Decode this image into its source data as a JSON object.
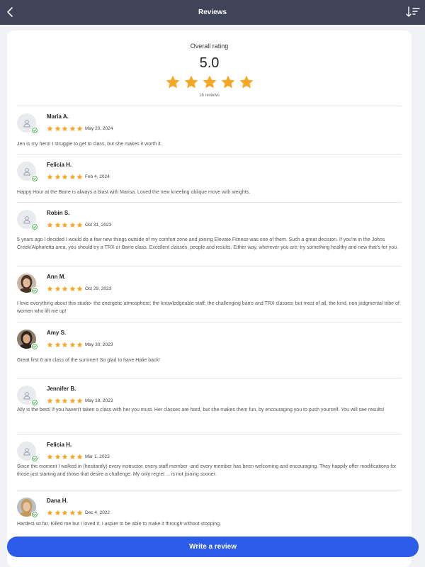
{
  "header": {
    "title": "Reviews",
    "back_icon": "chevron-left-icon",
    "sort_icon": "sort-descending-icon"
  },
  "colors": {
    "header_bg": "#3f4458",
    "star": "#f5a623",
    "button": "#2c5ce8",
    "verified": "#3cb043"
  },
  "summary": {
    "label": "Overall rating",
    "score": "5.0",
    "stars": 5,
    "count": "16 reviews"
  },
  "reviews": [
    {
      "name": "Maria A.",
      "date": "May 20, 2024",
      "rating": 5,
      "avatar": "placeholder",
      "text": "Jen is my hero! I struggle to get to class, but she makes it worth it."
    },
    {
      "name": "Felicia H.",
      "date": "Feb 4, 2024",
      "rating": 5,
      "avatar": "placeholder",
      "text": "Happy Hour at the Barre is always a blast with Marisa. Loved the new kneeling oblique move with weights."
    },
    {
      "name": "Robin S.",
      "date": "Oct 31, 2023",
      "rating": 5,
      "avatar": "placeholder",
      "text": "5 years ago I decided I would do a few new things outside of my comfort zone and joining Elevate Fitness was one of them. Such a great decision. If you're in the Johns Creek/Alpharetta area, you should try a TRX or Barre class. Excellent classes, people and results. Either way, wherever you are; try something healthy and new that's for you."
    },
    {
      "name": "Ann M.",
      "date": "Oct 29, 2023",
      "rating": 5,
      "avatar": "photo",
      "text": "I love everything about this studio- the energetic atmosphere; the knowledgeable staff; the challenging barre and TRX classes; but most of all, the kind, non judgmental tribe of women who lift me up!"
    },
    {
      "name": "Amy S.",
      "date": "May 30, 2023",
      "rating": 5,
      "avatar": "photo",
      "text": "Great first 6 am class of the summer! So glad to have Halie back!"
    },
    {
      "name": "Jennifer B.",
      "date": "May 18, 2023",
      "rating": 5,
      "avatar": "placeholder",
      "text": "Ally is the best! If you haven't taken a class with her you must. Her classes are hard, but she makes them fun, by encouraging you to push yourself. You will see results!"
    },
    {
      "name": "Felicia H.",
      "date": "Mar 1, 2023",
      "rating": 5,
      "avatar": "placeholder",
      "text": "Since the moment I walked in (hesitantly) every instructor, every staff member -and every member has been welcoming and encouraging. They happily offer modifications for those just starting and those that desire a challenge. My only regret ... is not joining sooner."
    },
    {
      "name": "Dana H.",
      "date": "Dec 4, 2022",
      "rating": 5,
      "avatar": "photo",
      "text": "Hardest so far. Killed me but I loved it. I aspire to be able to make it through without stopping."
    }
  ],
  "footer": {
    "write_review_label": "Write a review"
  }
}
